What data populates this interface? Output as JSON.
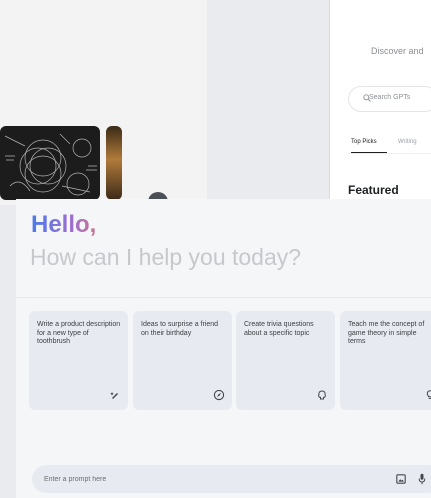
{
  "background": {
    "discover_text": "Discover and",
    "search_placeholder": "Search GPTs",
    "tabs": [
      {
        "label": "Top Picks",
        "active": true
      },
      {
        "label": "Writing",
        "active": false
      }
    ],
    "featured_heading": "Featured"
  },
  "greeting": {
    "hello": "Hello,",
    "subtitle": "How can I help you today?"
  },
  "suggestions": [
    {
      "text": "Write a product description for a new type of toothbrush",
      "icon": "pen-sparkle-icon"
    },
    {
      "text": "Ideas to surprise a friend on their birthday",
      "icon": "compass-icon"
    },
    {
      "text": "Create trivia questions about a specific topic",
      "icon": "brain-icon"
    },
    {
      "text": "Teach me the concept of game theory in simple terms",
      "icon": "lightbulb-icon"
    }
  ],
  "prompt": {
    "placeholder": "Enter a prompt here"
  },
  "colors": {
    "accent_blue": "#4b7be8",
    "accent_purple": "#9a6fd3",
    "card_bg": "#e7ebf1"
  }
}
